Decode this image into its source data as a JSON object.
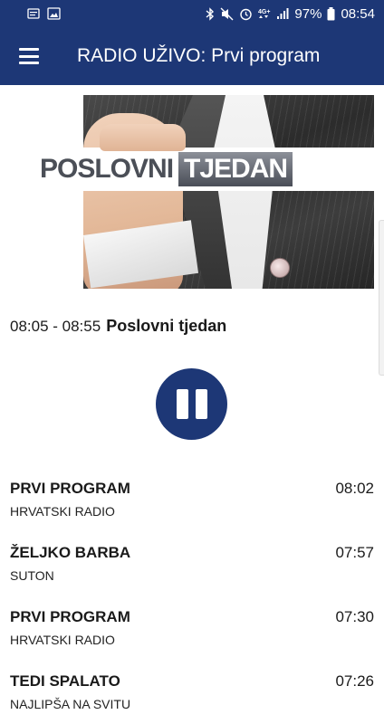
{
  "status_bar": {
    "battery": "97%",
    "time": "08:54"
  },
  "app_bar": {
    "title": "RADIO UŽIVO: Prvi program"
  },
  "banner": {
    "word1": "POSLOVNI",
    "word2": "TJEDAN"
  },
  "now_playing": {
    "time_range": "08:05 - 08:55",
    "show_name": "Poslovni tjedan"
  },
  "playlist": [
    {
      "title": "PRVI PROGRAM",
      "artist": "HRVATSKI RADIO",
      "time": "08:02"
    },
    {
      "title": "ŽELJKO BARBA",
      "artist": "SUTON",
      "time": "07:57"
    },
    {
      "title": "PRVI PROGRAM",
      "artist": "HRVATSKI RADIO",
      "time": "07:30"
    },
    {
      "title": "TEDI SPALATO",
      "artist": "NAJLIPŠA NA SVITU",
      "time": "07:26"
    }
  ],
  "colors": {
    "primary": "#1d3776",
    "background": "#ffffff"
  }
}
